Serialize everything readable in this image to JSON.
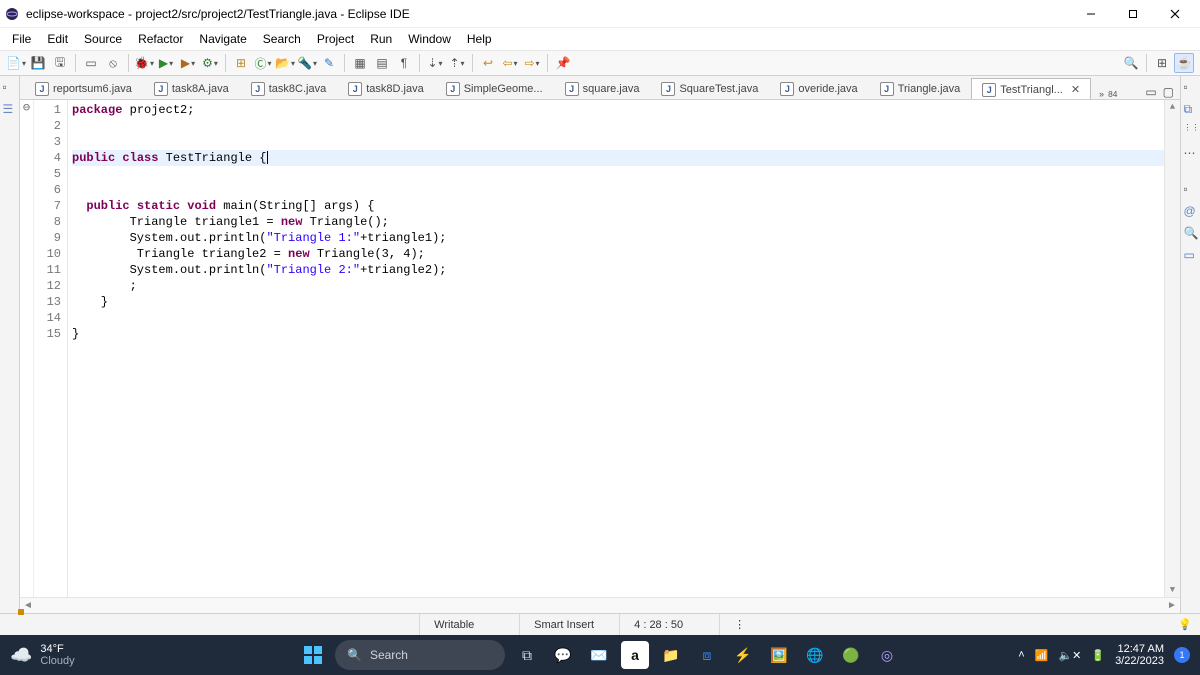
{
  "window": {
    "title": "eclipse-workspace - project2/src/project2/TestTriangle.java - Eclipse IDE"
  },
  "menu": [
    "File",
    "Edit",
    "Source",
    "Refactor",
    "Navigate",
    "Search",
    "Project",
    "Run",
    "Window",
    "Help"
  ],
  "tabs": [
    {
      "label": "reportsum6.java",
      "modified": false
    },
    {
      "label": "task8A.java",
      "modified": true
    },
    {
      "label": "task8C.java",
      "modified": false
    },
    {
      "label": "task8D.java",
      "modified": false
    },
    {
      "label": "SimpleGeome...",
      "modified": false
    },
    {
      "label": "square.java",
      "modified": true
    },
    {
      "label": "SquareTest.java",
      "modified": true
    },
    {
      "label": "overide.java",
      "modified": false
    },
    {
      "label": "Triangle.java",
      "modified": false
    },
    {
      "label": "TestTriangl...",
      "modified": false,
      "active": true
    }
  ],
  "tab_overflow": "84",
  "code": {
    "lines": [
      {
        "n": 1,
        "marker": "",
        "html": "<span class='kw'>package</span> project2;"
      },
      {
        "n": 2,
        "marker": "",
        "html": ""
      },
      {
        "n": 3,
        "marker": "",
        "html": ""
      },
      {
        "n": 4,
        "marker": "",
        "html": "<span class='kw'>public</span> <span class='kw'>class</span> TestTriangle {<span class='cursor'></span>",
        "highlight": true
      },
      {
        "n": 5,
        "marker": "",
        "html": ""
      },
      {
        "n": 6,
        "marker": "",
        "html": ""
      },
      {
        "n": 7,
        "marker": "⊖",
        "html": "  <span class='kw'>public</span> <span class='kw'>static</span> <span class='kw'>void</span> main(String[] args) {"
      },
      {
        "n": 8,
        "marker": "",
        "html": "        Triangle triangle1 = <span class='kw'>new</span> Triangle();"
      },
      {
        "n": 9,
        "marker": "",
        "html": "        System.out.println(<span class='str'>\"Triangle 1:\"</span>+triangle1);"
      },
      {
        "n": 10,
        "marker": "",
        "html": "         Triangle triangle2 = <span class='kw'>new</span> Triangle(3, 4);"
      },
      {
        "n": 11,
        "marker": "",
        "html": "        System.out.println(<span class='str'>\"Triangle 2:\"</span>+triangle2);"
      },
      {
        "n": 12,
        "marker": "",
        "html": "        ;"
      },
      {
        "n": 13,
        "marker": "",
        "html": "    }"
      },
      {
        "n": 14,
        "marker": "",
        "html": ""
      },
      {
        "n": 15,
        "marker": "",
        "html": "}"
      }
    ]
  },
  "status": {
    "writable": "Writable",
    "insert": "Smart Insert",
    "pos": "4 : 28 : 50"
  },
  "taskbar": {
    "temp": "34°F",
    "cond": "Cloudy",
    "search_placeholder": "Search",
    "time": "12:47 AM",
    "date": "3/22/2023"
  }
}
